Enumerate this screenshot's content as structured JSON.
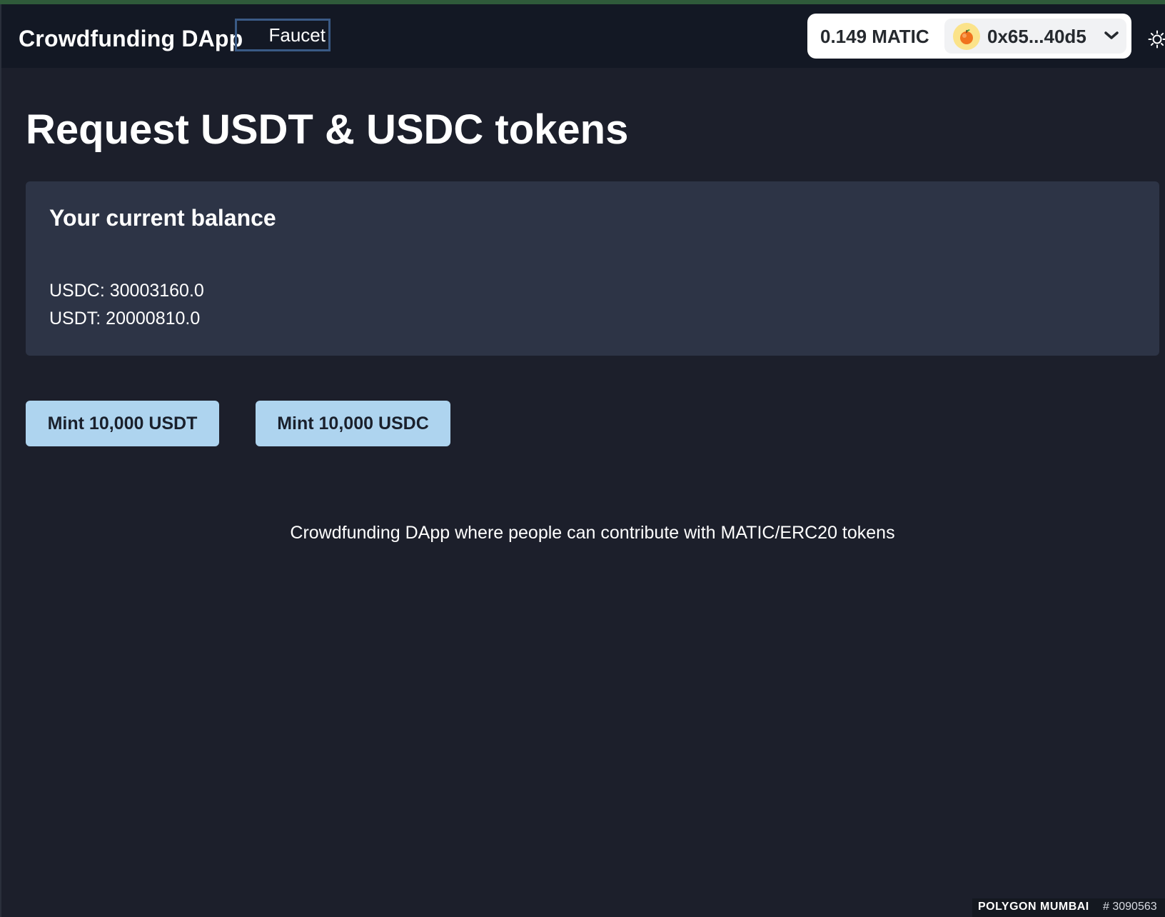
{
  "navbar": {
    "brand": "Crowdfunding DApp",
    "faucet_link": "Faucet"
  },
  "wallet": {
    "balance": "0.149 MATIC",
    "address": "0x65...40d5",
    "avatar_icon": "orange-emoji-icon",
    "chevron_icon": "chevron-down-icon",
    "theme_icon": "sun-icon"
  },
  "main": {
    "title": "Request USDT & USDC tokens",
    "balance_card": {
      "title": "Your current balance",
      "usdc": "USDC: 30003160.0",
      "usdt": "USDT: 20000810.0"
    },
    "buttons": {
      "mint_usdt": "Mint 10,000 USDT",
      "mint_usdc": "Mint 10,000 USDC"
    },
    "description": "Crowdfunding DApp where people can contribute with MATIC/ERC20 tokens"
  },
  "status_bar": {
    "network": "POLYGON MUMBAI",
    "block": "# 3090563"
  },
  "colors": {
    "background": "#1c1f2b",
    "navbar": "#131824",
    "card": "#2d3446",
    "button": "#aed4ef",
    "faucet_border": "#3a5a85",
    "top_accent": "#2f5a3a"
  }
}
